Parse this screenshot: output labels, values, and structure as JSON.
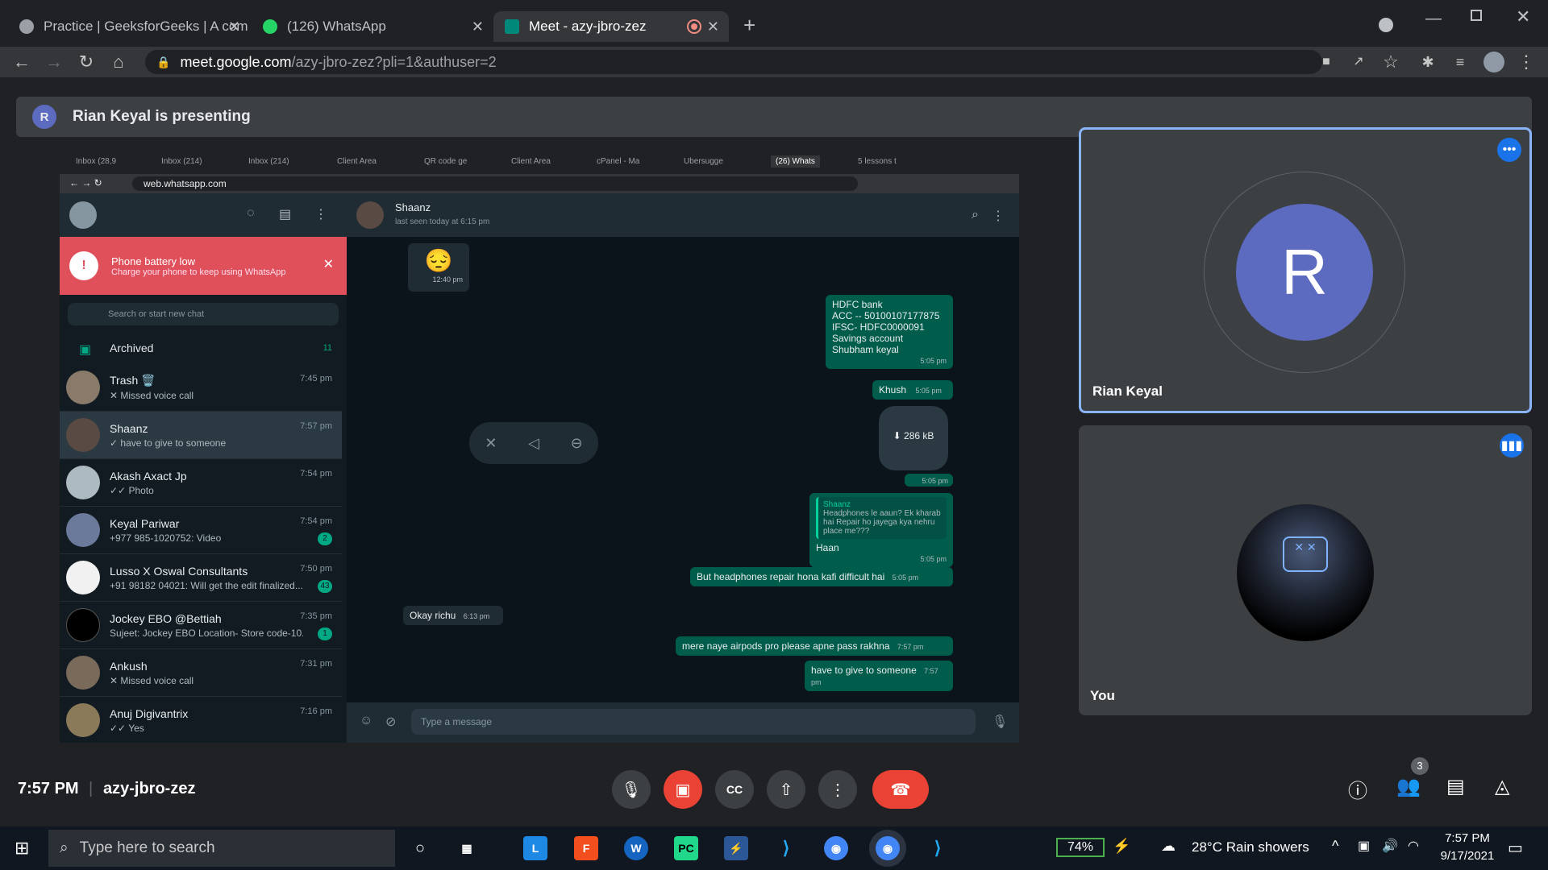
{
  "browser": {
    "tabs": [
      {
        "title": "Practice | GeeksforGeeks | A com",
        "favicon_color": "#9aa0a6"
      },
      {
        "title": "(126) WhatsApp",
        "favicon_color": "#25d366"
      },
      {
        "title": "Meet - azy-jbro-zez",
        "favicon_color": "#00897b"
      }
    ],
    "url_host": "meet.google.com",
    "url_path": "/azy-jbro-zez?pli=1&authuser=2"
  },
  "meet": {
    "presenting_avatar": "R",
    "presenting_text": "Rian Keyal is presenting",
    "participants": [
      {
        "name": "Rian Keyal",
        "avatar_letter": "R",
        "avatar_color": "#5c6bc0"
      },
      {
        "name": "You"
      }
    ],
    "time": "7:57 PM",
    "meeting_code": "azy-jbro-zez",
    "people_count": "3"
  },
  "shared": {
    "tabs": [
      "Inbox (28,9",
      "Inbox (214)",
      "Inbox (214)",
      "Client Area",
      "QR code ge",
      "Client Area",
      "cPanel - Ma",
      "Ubersugge",
      "(26) Whats",
      "5 lessons t"
    ],
    "url": "web.whatsapp.com",
    "battery_title": "Phone battery low",
    "battery_sub": "Charge your phone to keep using WhatsApp",
    "search_placeholder": "Search or start new chat",
    "archived_label": "Archived",
    "archived_count": "11",
    "chats": [
      {
        "name": "Trash 🗑️",
        "preview": "✕ Missed voice call",
        "time": "7:45 pm",
        "badge": ""
      },
      {
        "name": "Shaanz",
        "preview": "✓ have to give to someone",
        "time": "7:57 pm",
        "badge": ""
      },
      {
        "name": "Akash Axact Jp",
        "preview": "✓✓ Photo",
        "time": "7:54 pm",
        "badge": ""
      },
      {
        "name": "Keyal Pariwar",
        "preview": "+977 985-1020752: Video",
        "time": "7:54 pm",
        "badge": "2"
      },
      {
        "name": "Lusso X Oswal Consultants",
        "preview": "+91 98182 04021: Will get the edit finalized...",
        "time": "7:50 pm",
        "badge": "43"
      },
      {
        "name": "Jockey EBO @Bettiah",
        "preview": "Sujeet: Jockey EBO Location- Store code-10...",
        "time": "7:35 pm",
        "badge": "1"
      },
      {
        "name": "Ankush",
        "preview": "✕ Missed voice call",
        "time": "7:31 pm",
        "badge": ""
      },
      {
        "name": "Anuj Digivantrix",
        "preview": "✓✓ Yes",
        "time": "7:16 pm",
        "badge": ""
      }
    ],
    "contact_name": "Shaanz",
    "contact_status": "last seen today at 6:15 pm",
    "messages": {
      "emoji_time": "12:40 pm",
      "bank_lines": [
        "HDFC bank",
        "ACC -- 50100107177875",
        "IFSC- HDFC0000091",
        "Savings account",
        "Shubham keyal"
      ],
      "bank_time": "5:05 pm",
      "khush": "Khush",
      "khush_time": "5:05 pm",
      "file_size": "286 kB",
      "file_time": "5:05 pm",
      "quote_name": "Shaanz",
      "quote_text": "Headphones le aaun? Ek kharab hai Repair ho jayega kya nehru place me???",
      "haan": "Haan",
      "haan_time": "5:05 pm",
      "headphones": "But headphones repair hona kafi difficult hai",
      "headphones_time": "5:05 pm",
      "okay": "Okay richu",
      "okay_time": "6:13 pm",
      "airpods": "mere naye airpods pro please apne pass rakhna",
      "airpods_time": "7:57 pm",
      "give": "have to give to someone",
      "give_time": "7:57 pm"
    },
    "composer_placeholder": "Type a message"
  },
  "taskbar": {
    "search_placeholder": "Type here to search",
    "battery": "74%",
    "weather": "28°C  Rain showers",
    "clock_time": "7:57 PM",
    "clock_date": "9/17/2021"
  }
}
